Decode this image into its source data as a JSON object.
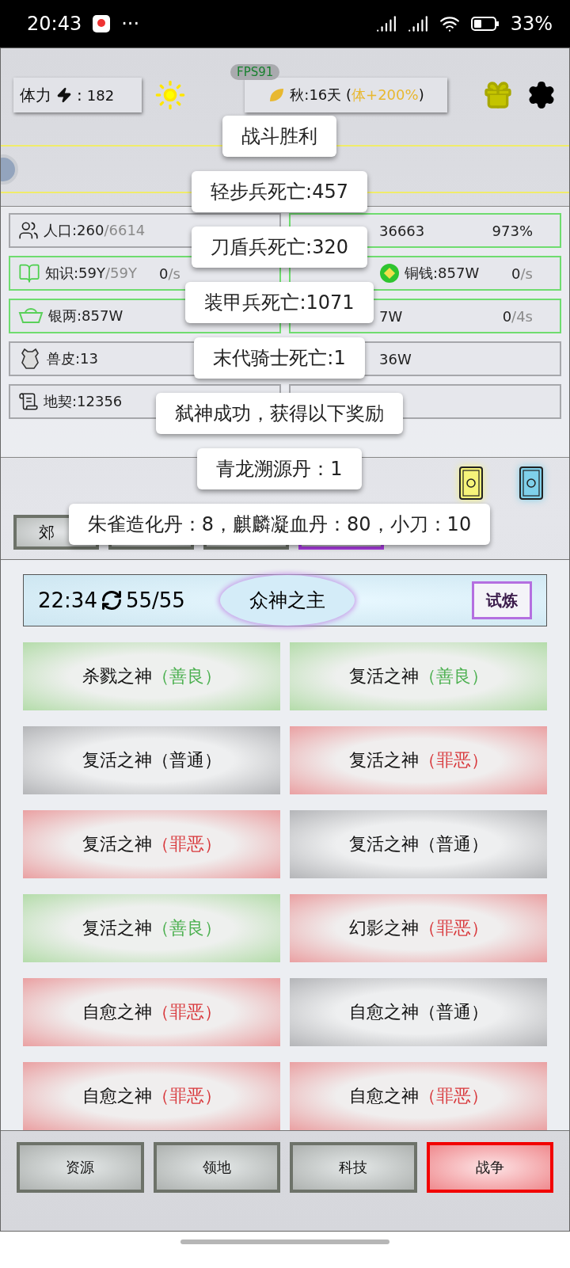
{
  "status_bar": {
    "time": "20:43",
    "dots": "···",
    "battery": "33%"
  },
  "header": {
    "stamina": {
      "label": "体力",
      "separator": ":",
      "value": "182"
    },
    "fps": "FPS91",
    "season": {
      "text": "秋:16天",
      "open": "(",
      "bonus": "体+200%",
      "close": ")"
    }
  },
  "resources": [
    {
      "text": "人口:260",
      "sub": "/6614",
      "highlight": false
    },
    {
      "text": "36663",
      "rate": "973%",
      "highlight": true
    },
    {
      "text": "知识:59Y",
      "sub": "/59Y",
      "rate": "0",
      "rate_sub": "/s",
      "highlight": true
    },
    {
      "text": "铜钱:857W",
      "rate": "0",
      "rate_sub": "/s",
      "highlight": true
    },
    {
      "text": "银两:857W",
      "highlight": true
    },
    {
      "text": "7W",
      "rate": "0",
      "rate_sub": "/4s",
      "highlight": true
    },
    {
      "text": "兽皮:13",
      "highlight": false
    },
    {
      "text": "36W",
      "highlight": false
    },
    {
      "text": "地契:12356",
      "highlight": false
    },
    {
      "highlight": false
    }
  ],
  "toasts": [
    "战斗胜利",
    "轻步兵死亡:457",
    "刀盾兵死亡:320",
    "装甲兵死亡:1071",
    "末代骑士死亡:1",
    "弑神成功，获得以下奖励",
    "青龙溯源丹：1",
    "朱雀造化丹：8，麒麟凝血丹：80，小刀：10"
  ],
  "tabs": [
    {
      "label": "郊",
      "selected": false
    },
    {
      "selected": false
    },
    {
      "selected": false
    },
    {
      "selected": true
    }
  ],
  "god_panel": {
    "timer": "22:34",
    "count": "55/55",
    "title": "众神之主",
    "button": "试炼"
  },
  "gods": [
    {
      "name": "杀戮之神",
      "tag": "（善良）",
      "kind": "good"
    },
    {
      "name": "复活之神",
      "tag": "（善良）",
      "kind": "good"
    },
    {
      "name": "复活之神",
      "tag": "（普通）",
      "kind": "normal"
    },
    {
      "name": "复活之神",
      "tag": "（罪恶）",
      "kind": "evil"
    },
    {
      "name": "复活之神",
      "tag": "（罪恶）",
      "kind": "evil"
    },
    {
      "name": "复活之神",
      "tag": "（普通）",
      "kind": "normal"
    },
    {
      "name": "复活之神",
      "tag": "（善良）",
      "kind": "good"
    },
    {
      "name": "幻影之神",
      "tag": "（罪恶）",
      "kind": "evil"
    },
    {
      "name": "自愈之神",
      "tag": "（罪恶）",
      "kind": "evil"
    },
    {
      "name": "自愈之神",
      "tag": "（普通）",
      "kind": "normal"
    },
    {
      "name": "自愈之神",
      "tag": "（罪恶）",
      "kind": "evil"
    },
    {
      "name": "自愈之神",
      "tag": "（罪恶）",
      "kind": "evil"
    }
  ],
  "nav": [
    {
      "label": "资源",
      "selected": false
    },
    {
      "label": "领地",
      "selected": false
    },
    {
      "label": "科技",
      "selected": false
    },
    {
      "label": "战争",
      "selected": true
    }
  ]
}
